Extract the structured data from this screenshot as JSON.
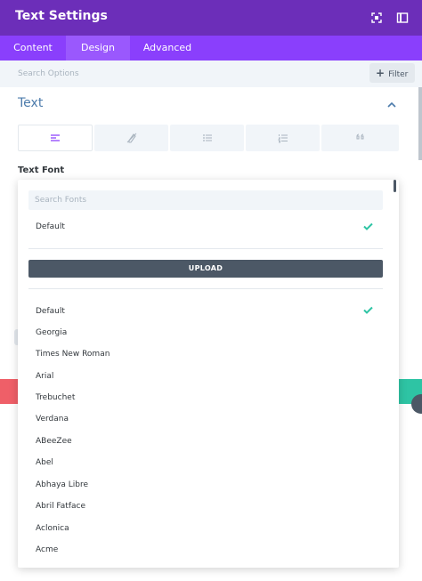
{
  "header": {
    "title": "Text Settings",
    "icons": [
      "fullscreen-icon",
      "split-view-icon"
    ],
    "bg_color": "#6c2eb9"
  },
  "tabs": [
    {
      "label": "Content",
      "active": false
    },
    {
      "label": "Design",
      "active": true
    },
    {
      "label": "Advanced",
      "active": false
    }
  ],
  "search": {
    "placeholder": "Search Options",
    "filter_label": "Filter"
  },
  "section": {
    "title": "Text",
    "collapse_icon": "chevron-up-icon",
    "alignment_buttons": [
      "align-left-icon",
      "clear-style-icon",
      "unordered-list-icon",
      "ordered-list-icon",
      "quote-icon"
    ]
  },
  "text_font": {
    "label": "Text Font",
    "search_placeholder": "Search Fonts",
    "selected": "Default",
    "upload_label": "UPLOAD",
    "fonts": [
      "Default",
      "Georgia",
      "Times New Roman",
      "Arial",
      "Trebuchet",
      "Verdana",
      "ABeeZee",
      "Abel",
      "Abhaya Libre",
      "Abril Fatface",
      "Aclonica",
      "Acme"
    ]
  },
  "colors": {
    "accent": "#8a3ffc",
    "check": "#2ec4a4"
  }
}
